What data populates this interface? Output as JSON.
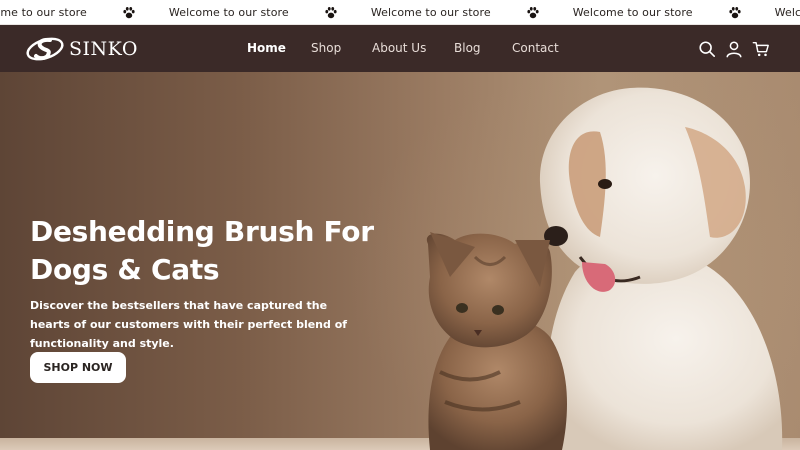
{
  "announcement": {
    "message": "Welcome to our store",
    "icon": "paw-icon"
  },
  "header": {
    "brand": "SINKO",
    "nav": [
      {
        "label": "Home",
        "active": true
      },
      {
        "label": "Shop",
        "active": false
      },
      {
        "label": "About Us",
        "active": false
      },
      {
        "label": "Blog",
        "active": false
      },
      {
        "label": "Contact",
        "active": false
      }
    ],
    "icons": [
      "search-icon",
      "account-icon",
      "cart-icon"
    ]
  },
  "hero": {
    "title": "Deshedding Brush For Dogs & Cats",
    "description": "Discover the bestsellers that have captured the hearts of our customers with their perfect blend of functionality and style.",
    "cta_label": "SHOP NOW"
  },
  "colors": {
    "header_bg": "#3b2a28",
    "announcement_bg": "#ffffff",
    "hero_text": "#ffffff",
    "button_bg": "#ffffff"
  }
}
